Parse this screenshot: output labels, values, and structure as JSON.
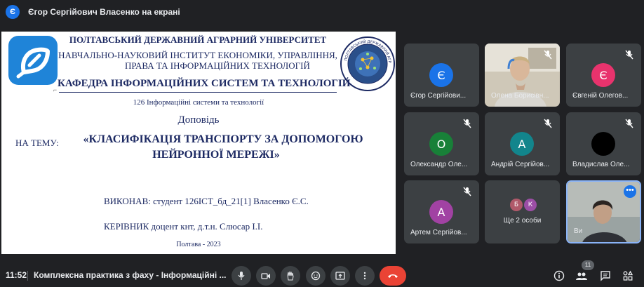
{
  "presenter": {
    "avatar_letter": "Є",
    "label": "Єгор Сергійович Власенко на екрані"
  },
  "slide": {
    "university": "ПОЛТАВСЬКИЙ ДЕРЖАВНИЙ АГРАРНИЙ УНІВЕРСИТЕТ",
    "institute_line1": "НАВЧАЛЬНО-НАУКОВИЙ ІНСТИТУТ ЕКОНОМІКИ, УПРАВЛІННЯ,",
    "institute_line2": "ПРАВА ТА ІНФОРМАЦІЙНИХ ТЕХНОЛОГІЙ",
    "department": "КАФЕДРА ІНФОРМАЦІЙНИХ СИСТЕМ ТА ТЕХНОЛОГІЙ",
    "specialty": "126 Інформаційні системи та технології",
    "report": "Доповідь",
    "theme_label": "НА ТЕМУ:",
    "theme_line1": "«КЛАСИФІКАЦІЯ ТРАНСПОРТУ ЗА ДОПОМОГОЮ",
    "theme_line2": "НЕЙРОННОЇ МЕРЕЖІ»",
    "author": "ВИКОНАВ: студент 126ІСТ_бд_21[1] Власенко Є.С.",
    "supervisor": "КЕРІВНИК доцент кнт, д.т.н. Слюсар І.І.",
    "city_year": "Полтава - 2023",
    "seal_text": "ПОЛТАВСЬКИЙ ДЕРЖАВНИЙ АГРАРНИЙ УНІВЕРСИТЕТ • ПДАУ"
  },
  "participants": [
    {
      "name": "Єгор Сергійови...",
      "letter": "Є",
      "color": "#1a73e8",
      "muted": false,
      "video": false
    },
    {
      "name": "Олена Борисівн...",
      "letter": "",
      "color": "",
      "muted": true,
      "video": true
    },
    {
      "name": "Євгеній Олегов...",
      "letter": "Є",
      "color": "#e8336d",
      "muted": true,
      "video": false
    },
    {
      "name": "Олександр Оле...",
      "letter": "О",
      "color": "#188038",
      "muted": true,
      "video": false
    },
    {
      "name": "Андрій Сергійов...",
      "letter": "А",
      "color": "#12858c",
      "muted": true,
      "video": false
    },
    {
      "name": "Владислав Оле...",
      "letter": "",
      "color": "#000000",
      "muted": true,
      "video": false
    },
    {
      "name": "Артем Сергійов...",
      "letter": "А",
      "color": "#a142a3",
      "muted": true,
      "video": false
    },
    {
      "name": "Ви",
      "letter": "",
      "color": "",
      "muted": false,
      "video": true,
      "active": true
    }
  ],
  "others": {
    "avatars": [
      {
        "letter": "Б",
        "color": "#b0596a"
      },
      {
        "letter": "К",
        "color": "#9c4ea6"
      }
    ],
    "label": "Ще 2 особи"
  },
  "bottombar": {
    "time": "11:52",
    "meeting_title": "Комплексна практика з фаху - Інформаційні ...",
    "people_count": "11",
    "end_call_color": "#ea4335",
    "icons": [
      "mic-icon",
      "camera-icon",
      "raise-hand-icon",
      "emoji-icon",
      "present-icon",
      "more-options-icon",
      "end-call-icon",
      "info-icon",
      "people-icon",
      "chat-icon",
      "activities-icon"
    ]
  },
  "colors": {
    "background": "#202124",
    "tile": "#3c4043",
    "accent": "#1a73e8",
    "slide_text": "#1d2a63"
  }
}
